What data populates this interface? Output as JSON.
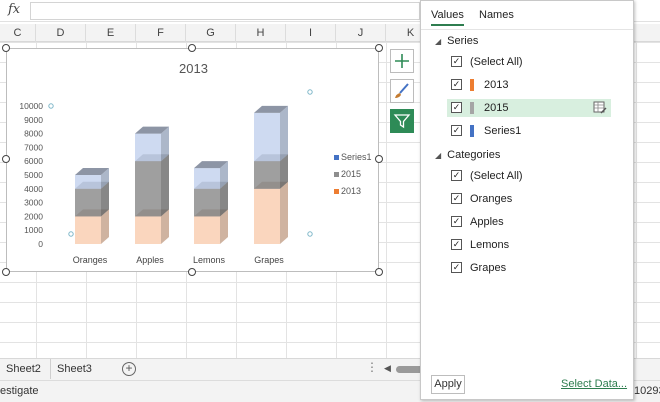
{
  "formula_bar": {
    "fx_label": "fx"
  },
  "columns": [
    "C",
    "D",
    "E",
    "F",
    "G",
    "H",
    "I",
    "J",
    "K"
  ],
  "chart_data": {
    "type": "bar",
    "title": "2013",
    "categories": [
      "Oranges",
      "Apples",
      "Lemons",
      "Grapes"
    ],
    "series": [
      {
        "name": "2013",
        "values": [
          2000,
          2000,
          2000,
          4000
        ],
        "color": "#f9cfb3"
      },
      {
        "name": "2015",
        "values": [
          2000,
          4000,
          2000,
          2000
        ],
        "color": "#8e8e8e"
      },
      {
        "name": "Series1",
        "values": [
          1000,
          2000,
          1500,
          3500
        ],
        "color": "#c6d4ef"
      }
    ],
    "ylim": [
      0,
      10000
    ],
    "y_ticks": [
      "0",
      "1000",
      "2000",
      "3000",
      "4000",
      "5000",
      "6000",
      "7000",
      "8000",
      "9000",
      "10000"
    ],
    "legend": [
      {
        "label": "Series1",
        "color": "#4472c4"
      },
      {
        "label": "2015",
        "color": "#8e8e8e"
      },
      {
        "label": "2013",
        "color": "#ed7d31"
      }
    ],
    "legend_position": "right"
  },
  "sheet_tabs": [
    "Sheet2",
    "Sheet3"
  ],
  "status": {
    "left": "estigate",
    "right": "10293"
  },
  "panel": {
    "tabs": [
      "Values",
      "Names"
    ],
    "series_heading": "Series",
    "categories_heading": "Categories",
    "series_items": [
      {
        "label": "(Select All)",
        "checked": true,
        "color": ""
      },
      {
        "label": "2013",
        "checked": true,
        "color": "#ed7d31"
      },
      {
        "label": "2015",
        "checked": true,
        "color": "#a5a5a5"
      },
      {
        "label": "Series1",
        "checked": true,
        "color": "#4472c4"
      }
    ],
    "category_items": [
      {
        "label": "(Select All)",
        "checked": true
      },
      {
        "label": "Oranges",
        "checked": true
      },
      {
        "label": "Apples",
        "checked": true
      },
      {
        "label": "Lemons",
        "checked": true
      },
      {
        "label": "Grapes",
        "checked": true
      }
    ],
    "apply_label": "Apply",
    "select_data_label": "Select Data..."
  }
}
